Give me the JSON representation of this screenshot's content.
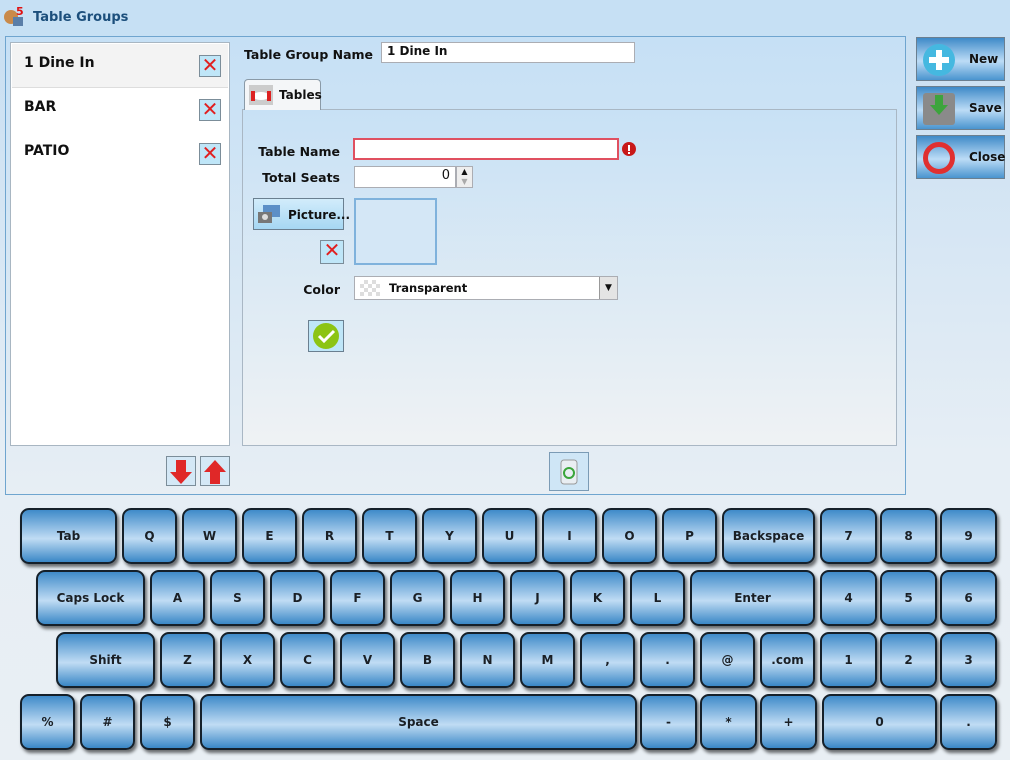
{
  "window": {
    "title": "Table Groups",
    "app_icon": "pos-app-icon"
  },
  "groups": [
    {
      "name": "1 Dine In",
      "selected": true
    },
    {
      "name": "BAR",
      "selected": false
    },
    {
      "name": "PATIO",
      "selected": false
    }
  ],
  "form": {
    "group_name_label": "Table Group Name",
    "group_name_value": "1 Dine In",
    "tab_label": "Tables",
    "table_name_label": "Table Name",
    "table_name_value": "",
    "total_seats_label": "Total Seats",
    "total_seats_value": "0",
    "picture_label": "Picture...",
    "color_label": "Color",
    "color_value": "Transparent"
  },
  "side_buttons": {
    "new": "New",
    "save": "Save",
    "close": "Close"
  },
  "colors": {
    "error": "#e03c3c",
    "accent": "#3f8bc9"
  },
  "keyboard": {
    "rows": [
      [
        "Tab",
        "Q",
        "W",
        "E",
        "R",
        "T",
        "Y",
        "U",
        "I",
        "O",
        "P",
        "Backspace",
        "7",
        "8",
        "9"
      ],
      [
        "Caps Lock",
        "A",
        "S",
        "D",
        "F",
        "G",
        "H",
        "J",
        "K",
        "L",
        "Enter",
        "4",
        "5",
        "6"
      ],
      [
        "Shift",
        "Z",
        "X",
        "C",
        "V",
        "B",
        "N",
        "M",
        ",",
        ".",
        "@",
        ".com",
        "1",
        "2",
        "3"
      ],
      [
        "%",
        "#",
        "$",
        "Space",
        "-",
        "*",
        "+",
        "0",
        "."
      ]
    ]
  }
}
